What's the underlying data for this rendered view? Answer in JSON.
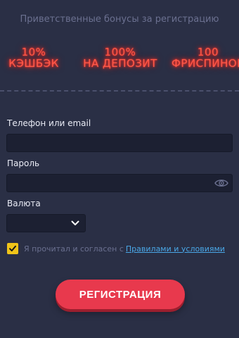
{
  "header": {
    "title": "Приветственные бонусы за регистрацию"
  },
  "bonuses": [
    {
      "line1": "10%",
      "line2": "КЭШБЭК"
    },
    {
      "line1": "100%",
      "line2": "НА ДЕПОЗИТ"
    },
    {
      "line1": "100",
      "line2": "ФРИСПИНОВ"
    }
  ],
  "form": {
    "login_label": "Телефон или email",
    "login_value": "",
    "password_label": "Пароль",
    "password_value": "",
    "currency_label": "Валюта",
    "currency_value": "",
    "agree_text": "Я прочитал и согласен с",
    "agree_link": "Правилами и условиями",
    "agree_checked": true
  },
  "actions": {
    "register_label": "РЕГИСТРАЦИЯ"
  },
  "colors": {
    "background": "#2a2f45",
    "neon": "#ff5a4a",
    "checkbox": "#f0c419",
    "link": "#4aa8e8",
    "button": "#e8394d"
  },
  "icons": {
    "password_toggle": "eye-icon",
    "currency_dropdown": "chevron-down-icon",
    "agree_check": "check-icon"
  }
}
